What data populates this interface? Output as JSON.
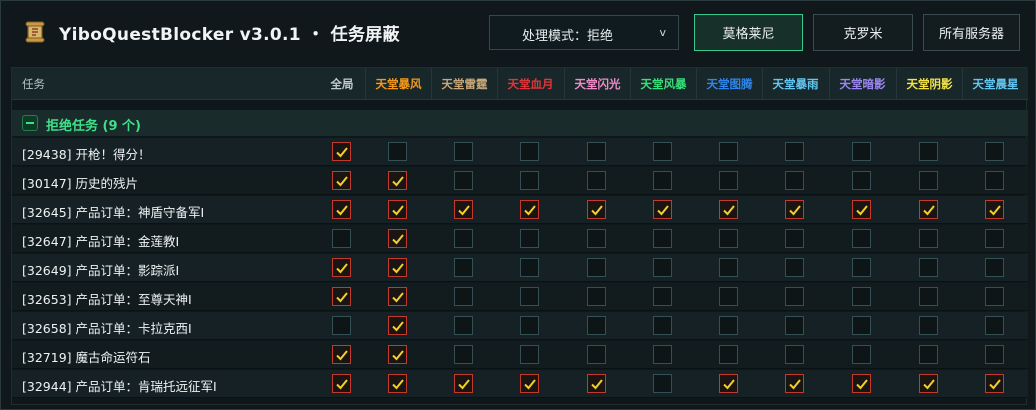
{
  "app": {
    "title": "YiboQuestBlocker v3.0.1 ・ 任务屏蔽"
  },
  "mode": {
    "label": "处理模式：拒绝",
    "chevron": "v"
  },
  "servers": [
    {
      "label": "莫格莱尼",
      "active": true
    },
    {
      "label": "克罗米",
      "active": false
    },
    {
      "label": "所有服务器",
      "active": false
    }
  ],
  "table": {
    "task_header": "任务",
    "columns": [
      {
        "label": "全局",
        "color": "#c2cacc"
      },
      {
        "label": "天堂暴风",
        "color": "#f39a1e"
      },
      {
        "label": "天堂雷霆",
        "color": "#c9a77a"
      },
      {
        "label": "天堂血月",
        "color": "#e0353b"
      },
      {
        "label": "天堂闪光",
        "color": "#f08cc8"
      },
      {
        "label": "天堂风暴",
        "color": "#38e07a"
      },
      {
        "label": "天堂图腾",
        "color": "#2f86e8"
      },
      {
        "label": "天堂暴雨",
        "color": "#62c7f2"
      },
      {
        "label": "天堂暗影",
        "color": "#9b86f2"
      },
      {
        "label": "天堂阴影",
        "color": "#f4e34a"
      },
      {
        "label": "天堂晨星",
        "color": "#62c7f2"
      }
    ],
    "group": {
      "label": "拒绝任务 (9 个)"
    },
    "rows": [
      {
        "name": "[29438] 开枪！得分！",
        "checks": [
          1,
          0,
          0,
          0,
          0,
          0,
          0,
          0,
          0,
          0,
          0
        ]
      },
      {
        "name": "[30147] 历史的残片",
        "checks": [
          1,
          1,
          0,
          0,
          0,
          0,
          0,
          0,
          0,
          0,
          0
        ]
      },
      {
        "name": "[32645] 产品订单：神盾守备军I",
        "checks": [
          1,
          1,
          1,
          1,
          1,
          1,
          1,
          1,
          1,
          1,
          1
        ]
      },
      {
        "name": "[32647] 产品订单：金莲教I",
        "checks": [
          0,
          1,
          0,
          0,
          0,
          0,
          0,
          0,
          0,
          0,
          0
        ]
      },
      {
        "name": "[32649] 产品订单：影踪派I",
        "checks": [
          1,
          1,
          0,
          0,
          0,
          0,
          0,
          0,
          0,
          0,
          0
        ]
      },
      {
        "name": "[32653] 产品订单：至尊天神I",
        "checks": [
          1,
          1,
          0,
          0,
          0,
          0,
          0,
          0,
          0,
          0,
          0
        ]
      },
      {
        "name": "[32658] 产品订单：卡拉克西I",
        "checks": [
          0,
          1,
          0,
          0,
          0,
          0,
          0,
          0,
          0,
          0,
          0
        ]
      },
      {
        "name": "[32719] 魔古命运符石",
        "checks": [
          1,
          1,
          0,
          0,
          0,
          0,
          0,
          0,
          0,
          0,
          0
        ]
      },
      {
        "name": "[32944] 产品订单：肯瑞托远征军I",
        "checks": [
          1,
          1,
          1,
          1,
          1,
          0,
          1,
          1,
          1,
          1,
          1
        ]
      }
    ]
  },
  "icons": {
    "logo": "scroll-icon",
    "check": "check-icon",
    "collapse": "minus-icon"
  },
  "colors": {
    "accent_green": "#3fe08a",
    "check_red": "#c23a2c",
    "check_mark": "#f2d027"
  }
}
